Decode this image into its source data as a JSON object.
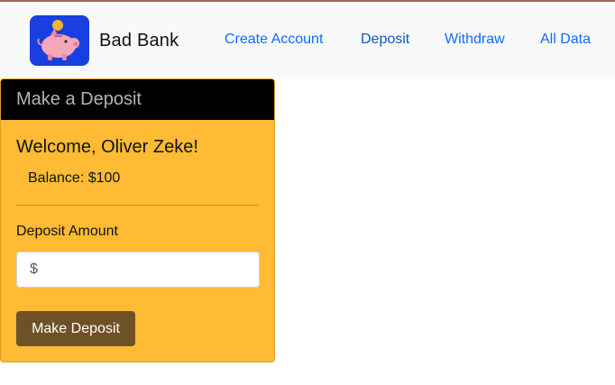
{
  "brand": {
    "name": "Bad Bank",
    "logo_icon": "piggy-bank-icon",
    "logo_bg": "#1a3fe0"
  },
  "nav": {
    "links": [
      {
        "label": "Create Account"
      },
      {
        "label": "Deposit"
      },
      {
        "label": "Withdraw"
      },
      {
        "label": "All Data"
      }
    ]
  },
  "card": {
    "header": "Make a Deposit",
    "welcome": "Welcome, Oliver Zeke!",
    "balance": "Balance: $100",
    "amount_label": "Deposit Amount",
    "amount_placeholder": "$",
    "submit_label": "Make Deposit"
  },
  "colors": {
    "card_bg": "#ffbb33",
    "card_header_bg": "#000000",
    "button_bg": "#6f5127",
    "link": "#0d6efd"
  }
}
